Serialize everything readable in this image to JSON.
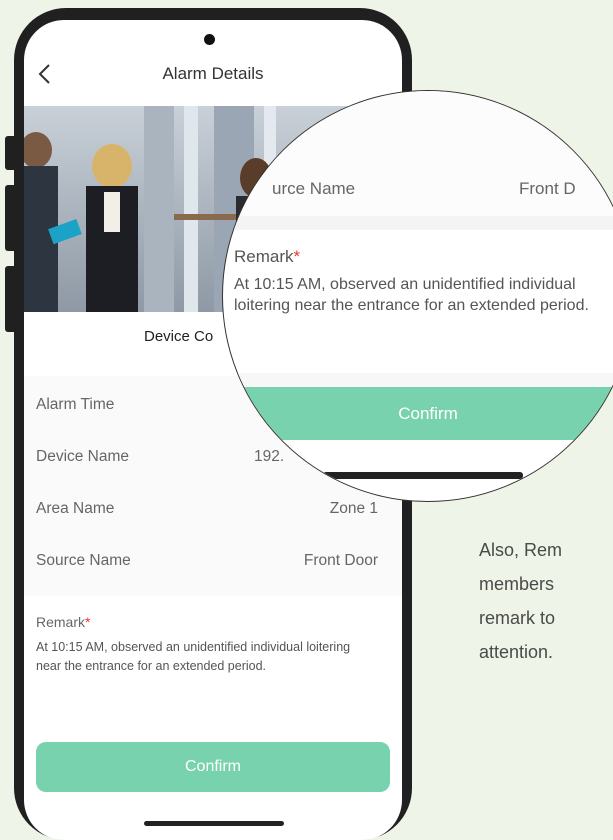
{
  "header": {
    "title": "Alarm Details",
    "back_icon": "chevron-left-icon"
  },
  "section_title": "Device Co",
  "fields": [
    {
      "label": "Alarm Time",
      "value": ""
    },
    {
      "label": "Device Name",
      "value": "192."
    },
    {
      "label": "Area Name",
      "value": "Zone 1"
    },
    {
      "label": "Source Name",
      "value": "Front Door"
    }
  ],
  "remark": {
    "label": "Remark",
    "required_mark": "*",
    "text": "At 10:15 AM, observed an unidentified individual loitering near the entrance for an extended period."
  },
  "confirm_label": "Confirm",
  "magnifier": {
    "source_label": "urce Name",
    "source_value": "Front D",
    "remark_label": "Remark",
    "remark_text": "At 10:15 AM, observed an unidentified individual loitering near the entrance for an extended period.",
    "confirm_label": "Confirm"
  },
  "caption": {
    "line1": "Also, Rem",
    "line2": "members",
    "line3": "remark to",
    "line4": "attention."
  },
  "colors": {
    "accent": "#77d2ad",
    "required": "#e53935",
    "background": "#eef4e8"
  }
}
